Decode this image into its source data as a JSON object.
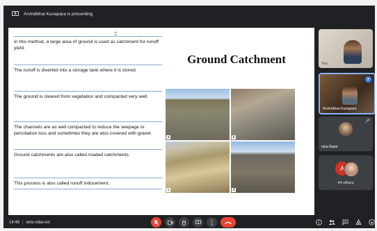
{
  "presentation_banner": {
    "text": "Arvindbhai Kunapara is presenting"
  },
  "slide": {
    "title": "Ground Catchment",
    "bullets": [
      "In this method, a large area of ground is used as catchment for runoff yield.",
      "The runoff is diverted into a storage tank where it is stored.",
      "The ground is cleared from vegetation and compacted very well.",
      "The channels are as well compacted to reduce the seepage or percolation loss and sometimes they are also covered with gravel.",
      "Ground catchments are also called roaded catchments.",
      "This process is also called runoff inducement."
    ],
    "photo_labels": [
      "a",
      "b",
      "c",
      "d"
    ]
  },
  "participants": [
    {
      "name": "You"
    },
    {
      "name": "Arvindbhai Kunapara"
    },
    {
      "name": "Isha Rami"
    },
    {
      "name": "44 others",
      "initial": "A"
    }
  ],
  "bottom_bar": {
    "time": "14:48",
    "separator": "|",
    "meeting_code": "emc-vdai-vsr"
  },
  "colors": {
    "end_call": "#ea4335",
    "mic_off": "#ea4335",
    "active_border": "#8ab4f8",
    "background": "#202124"
  }
}
